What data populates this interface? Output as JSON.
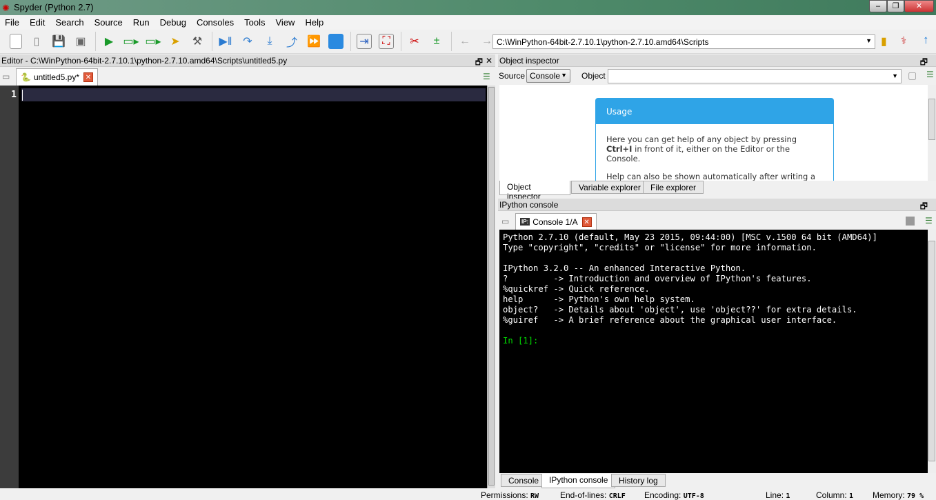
{
  "window": {
    "title": "Spyder (Python 2.7)"
  },
  "menu": [
    "File",
    "Edit",
    "Search",
    "Source",
    "Run",
    "Debug",
    "Consoles",
    "Tools",
    "View",
    "Help"
  ],
  "toolbar": {
    "path": "C:\\WinPython-64bit-2.7.10.1\\python-2.7.10.amd64\\Scripts"
  },
  "editor": {
    "title": "Editor - C:\\WinPython-64bit-2.7.10.1\\python-2.7.10.amd64\\Scripts\\untitled5.py",
    "tab": "untitled5.py*",
    "line_number": "1"
  },
  "inspector": {
    "title": "Object inspector",
    "source_label": "Source",
    "source_value": "Console",
    "object_label": "Object",
    "object_value": "",
    "usage_title": "Usage",
    "usage_p1a": "Here you can get help of any object by pressing ",
    "usage_p1b": "Ctrl+I",
    "usage_p1c": " in front of it, either on the Editor or the Console.",
    "usage_p2": "Help can also be shown automatically after writing a left parenthesis next to an object. You can activate this",
    "tabs": [
      "Object inspector",
      "Variable explorer",
      "File explorer"
    ]
  },
  "ipython": {
    "title": "IPython console",
    "tab": "Console 1/A",
    "lines": [
      "Python 2.7.10 (default, May 23 2015, 09:44:00) [MSC v.1500 64 bit (AMD64)]",
      "Type \"copyright\", \"credits\" or \"license\" for more information.",
      "",
      "IPython 3.2.0 -- An enhanced Interactive Python.",
      "?         -> Introduction and overview of IPython's features.",
      "%quickref -> Quick reference.",
      "help      -> Python's own help system.",
      "object?   -> Details about 'object', use 'object??' for extra details.",
      "%guiref   -> A brief reference about the graphical user interface."
    ],
    "prompt": "In [1]:",
    "bottom_tabs": [
      "Console",
      "IPython console",
      "History log"
    ]
  },
  "status": {
    "permissions_label": "Permissions:",
    "permissions": "RW",
    "eol_label": "End-of-lines:",
    "eol": "CRLF",
    "encoding_label": "Encoding:",
    "encoding": "UTF-8",
    "line_label": "Line:",
    "line": "1",
    "column_label": "Column:",
    "column": "1",
    "memory_label": "Memory:",
    "memory": "79 %"
  }
}
